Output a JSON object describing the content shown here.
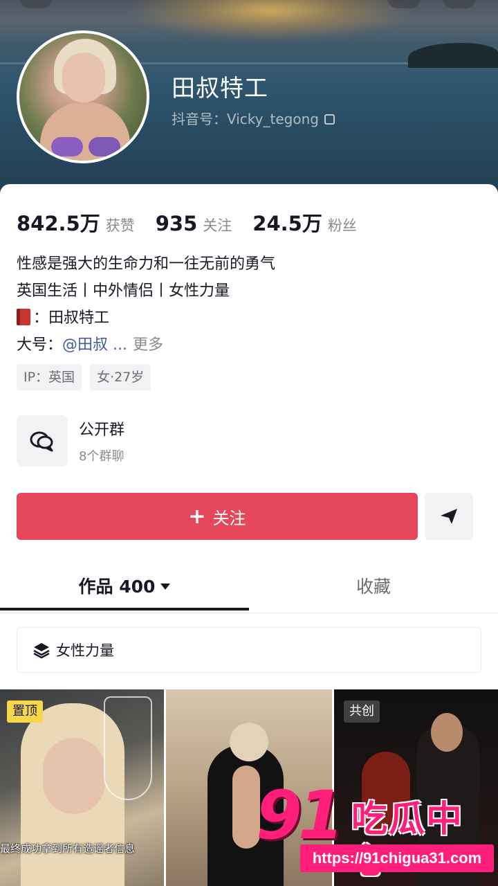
{
  "profile": {
    "nickname": "田叔特工",
    "douyin_id": "抖音号：Vicky_tegong"
  },
  "stats": [
    {
      "value": "842.5万",
      "label": "获赞"
    },
    {
      "value": "935",
      "label": "关注"
    },
    {
      "value": "24.5万",
      "label": "粉丝"
    }
  ],
  "bio": {
    "line1": "性感是强大的生命力和一往无前的勇气",
    "line2": "英国生活丨中外情侣丨女性力量",
    "line3": "：田叔特工",
    "line4_prefix": "大号：",
    "line4_mention": "@田叔 ...",
    "more": "更多"
  },
  "tags": [
    "IP：英国",
    "女·27岁"
  ],
  "group": {
    "title": "公开群",
    "subtitle": "8个群聊"
  },
  "actions": {
    "follow_plus": "+",
    "follow_label": "关注"
  },
  "tabs": {
    "works": "作品 400",
    "favorites": "收藏"
  },
  "collection": {
    "label": "女性力量"
  },
  "videos": [
    {
      "badge": "置顶",
      "caption": "最终成功拿到所有造谣者信息"
    },
    {
      "badge": "",
      "caption": ""
    },
    {
      "badge": "共创",
      "caption": ""
    }
  ],
  "watermark": {
    "number": "91",
    "text": "吃瓜中心",
    "url": "https://91chigua31.com"
  },
  "colors": {
    "follow_button": "#e5485b",
    "pin_badge": "#f8d64a",
    "mention": "#3f5b9e",
    "watermark": "#ff1f7a"
  }
}
